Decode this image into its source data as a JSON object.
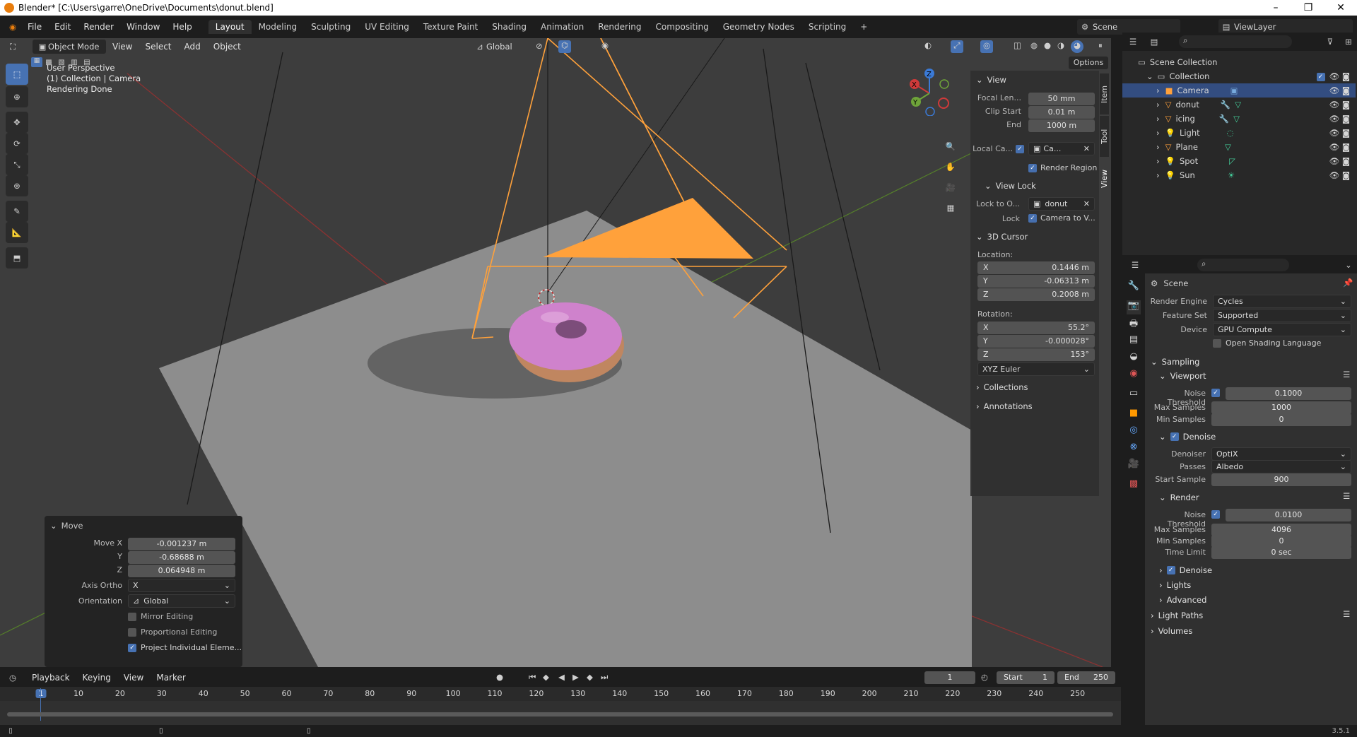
{
  "window": {
    "title": "Blender* [C:\\Users\\garre\\OneDrive\\Documents\\donut.blend]",
    "controls": [
      "–",
      "❐",
      "✕"
    ]
  },
  "menu": [
    "File",
    "Edit",
    "Render",
    "Window",
    "Help"
  ],
  "workspaces": [
    "Layout",
    "Modeling",
    "Sculpting",
    "UV Editing",
    "Texture Paint",
    "Shading",
    "Animation",
    "Rendering",
    "Compositing",
    "Geometry Nodes",
    "Scripting",
    "+"
  ],
  "scene": "Scene",
  "view_layer": "ViewLayer",
  "viewport_header": {
    "mode": "Object Mode",
    "menus": [
      "View",
      "Select",
      "Add",
      "Object"
    ],
    "orientation": "Global",
    "options": "Options"
  },
  "overlay_text": [
    "User Perspective",
    "(1) Collection | Camera",
    "Rendering Done"
  ],
  "side_tabs": [
    "Item",
    "Tool",
    "View"
  ],
  "n_panel": {
    "view_header": "View",
    "focal_label": "Focal Len...",
    "focal": "50 mm",
    "clip_start_label": "Clip Start",
    "clip_start": "0.01 m",
    "clip_end_label": "End",
    "clip_end": "1000 m",
    "local_cam_label": "Local Ca...",
    "local_cam": "Ca...",
    "render_region": "Render Region",
    "view_lock_header": "View Lock",
    "lock_to_label": "Lock to O...",
    "lock_to": "donut",
    "lock_label": "Lock",
    "lock_value": "Camera to V...",
    "cursor_header": "3D Cursor",
    "location_label": "Location:",
    "loc": [
      {
        "axis": "X",
        "value": "0.1446 m"
      },
      {
        "axis": "Y",
        "value": "-0.06313 m"
      },
      {
        "axis": "Z",
        "value": "0.2008 m"
      }
    ],
    "rotation_label": "Rotation:",
    "rot": [
      {
        "axis": "X",
        "value": "55.2°"
      },
      {
        "axis": "Y",
        "value": "-0.000028°"
      },
      {
        "axis": "Z",
        "value": "153°"
      }
    ],
    "rot_mode": "XYZ Euler",
    "collections": "Collections",
    "annotations": "Annotations"
  },
  "move_panel": {
    "title": "Move",
    "move_x_label": "Move X",
    "move_x": "-0.001237 m",
    "y_label": "Y",
    "y": "-0.68688 m",
    "z_label": "Z",
    "z": "0.064948 m",
    "axis_ortho_label": "Axis Ortho",
    "axis_ortho": "X",
    "orientation_label": "Orientation",
    "orientation": "Global",
    "mirror": "Mirror Editing",
    "proportional": "Proportional Editing",
    "project": "Project Individual Eleme..."
  },
  "outliner": {
    "scene_collection": "Scene Collection",
    "collection": "Collection",
    "items": [
      {
        "name": "Camera",
        "icon": "camera-icon"
      },
      {
        "name": "donut",
        "icon": "mesh-icon"
      },
      {
        "name": "icing",
        "icon": "mesh-icon"
      },
      {
        "name": "Light",
        "icon": "light-icon"
      },
      {
        "name": "Plane",
        "icon": "mesh-icon"
      },
      {
        "name": "Spot",
        "icon": "light-icon"
      },
      {
        "name": "Sun",
        "icon": "light-icon"
      }
    ]
  },
  "properties": {
    "scene": "Scene",
    "render_engine_label": "Render Engine",
    "render_engine": "Cycles",
    "feature_set_label": "Feature Set",
    "feature_set": "Supported",
    "device_label": "Device",
    "device": "GPU Compute",
    "osl": "Open Shading Language",
    "sampling": "Sampling",
    "viewport": "Viewport",
    "vp_noise_label": "Noise Threshold",
    "vp_noise": "0.1000",
    "vp_max_label": "Max Samples",
    "vp_max": "1000",
    "vp_min_label": "Min Samples",
    "vp_min": "0",
    "denoise": "Denoise",
    "denoiser_label": "Denoiser",
    "denoiser": "OptiX",
    "passes_label": "Passes",
    "passes": "Albedo",
    "start_sample_label": "Start Sample",
    "start_sample": "900",
    "render": "Render",
    "r_noise_label": "Noise Threshold",
    "r_noise": "0.0100",
    "r_max_label": "Max Samples",
    "r_max": "4096",
    "r_min_label": "Min Samples",
    "r_min": "0",
    "time_limit_label": "Time Limit",
    "time_limit": "0 sec",
    "r_denoise": "Denoise",
    "lights": "Lights",
    "advanced": "Advanced",
    "light_paths": "Light Paths",
    "volumes": "Volumes"
  },
  "timeline": {
    "menus": [
      "Playback",
      "Keying",
      "View",
      "Marker"
    ],
    "current_frame": "1",
    "start_label": "Start",
    "start": "1",
    "end_label": "End",
    "end": "250",
    "ticks": [
      "1",
      "10",
      "20",
      "30",
      "40",
      "50",
      "60",
      "70",
      "80",
      "90",
      "100",
      "110",
      "120",
      "130",
      "140",
      "150",
      "160",
      "170",
      "180",
      "190",
      "200",
      "210",
      "220",
      "230",
      "240",
      "250"
    ]
  },
  "version": "3.5.1",
  "colors": {
    "accent": "#4772b3",
    "camera": "#ffa13b",
    "icing": "#d08ad8",
    "viewport_bg": "#3d3d3d"
  }
}
